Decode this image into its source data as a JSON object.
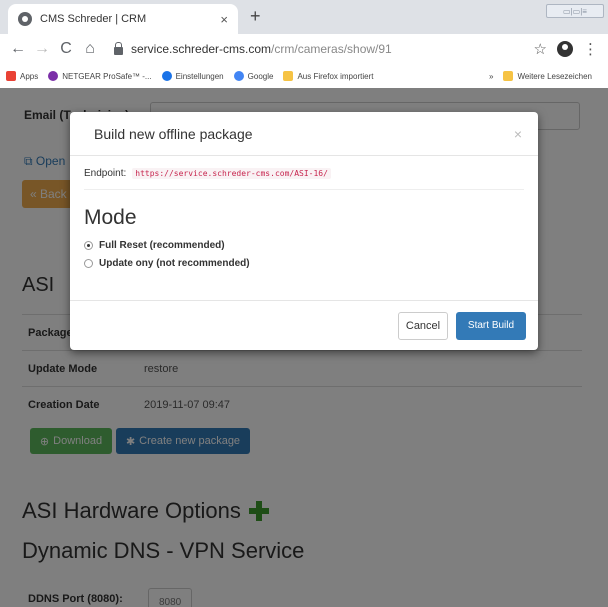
{
  "browser": {
    "tab_title": "CMS Schreder | CRM",
    "tab_close": "×",
    "new_tab": "+",
    "url_host": "service.schreder-cms.com",
    "url_path": "/crm/cameras/show/91",
    "window_controls": "▭|▭|≡",
    "bookmarks": [
      {
        "label": "Apps",
        "color": "#e94235"
      },
      {
        "label": "NETGEAR ProSafe™ -...",
        "color": "#7b2fa8"
      },
      {
        "label": "Einstellungen",
        "color": "#1a73e8"
      },
      {
        "label": "Google",
        "color": "#4285f4"
      },
      {
        "label": "Aus Firefox importiert",
        "color": "#f6c344"
      }
    ],
    "bookmarks_overflow": "»",
    "other_bookmarks": "Weitere Lesezeichen"
  },
  "page": {
    "email_label": "Email (Technician)",
    "open_link": "Open",
    "back_button": "« Back",
    "asi_heading": "ASI",
    "rows": [
      {
        "key": "Package",
        "value": ""
      },
      {
        "key": "Update Mode",
        "value": "restore"
      },
      {
        "key": "Creation Date",
        "value": "2019-11-07 09:47"
      }
    ],
    "download_button": "Download",
    "create_button": "Create new package",
    "hardware_heading": "ASI Hardware Options",
    "dns_heading": "Dynamic DNS - VPN Service",
    "ddns_label": "DDNS Port (8080):",
    "ddns_value": "8080"
  },
  "modal": {
    "title": "Build new offline package",
    "close": "×",
    "endpoint_label": "Endpoint:",
    "endpoint_url": "https://service.schreder-cms.com/ASI-16/",
    "mode_heading": "Mode",
    "options": [
      {
        "label": "Full Reset (recommended)",
        "checked": true
      },
      {
        "label": "Update ony (not recommended)",
        "checked": false
      }
    ],
    "cancel_button": "Cancel",
    "start_button": "Start Build"
  },
  "colors": {
    "primary": "#337ab7",
    "success": "#5cb85c",
    "warning": "#f0ad4e",
    "plus": "#3c9a2c"
  }
}
